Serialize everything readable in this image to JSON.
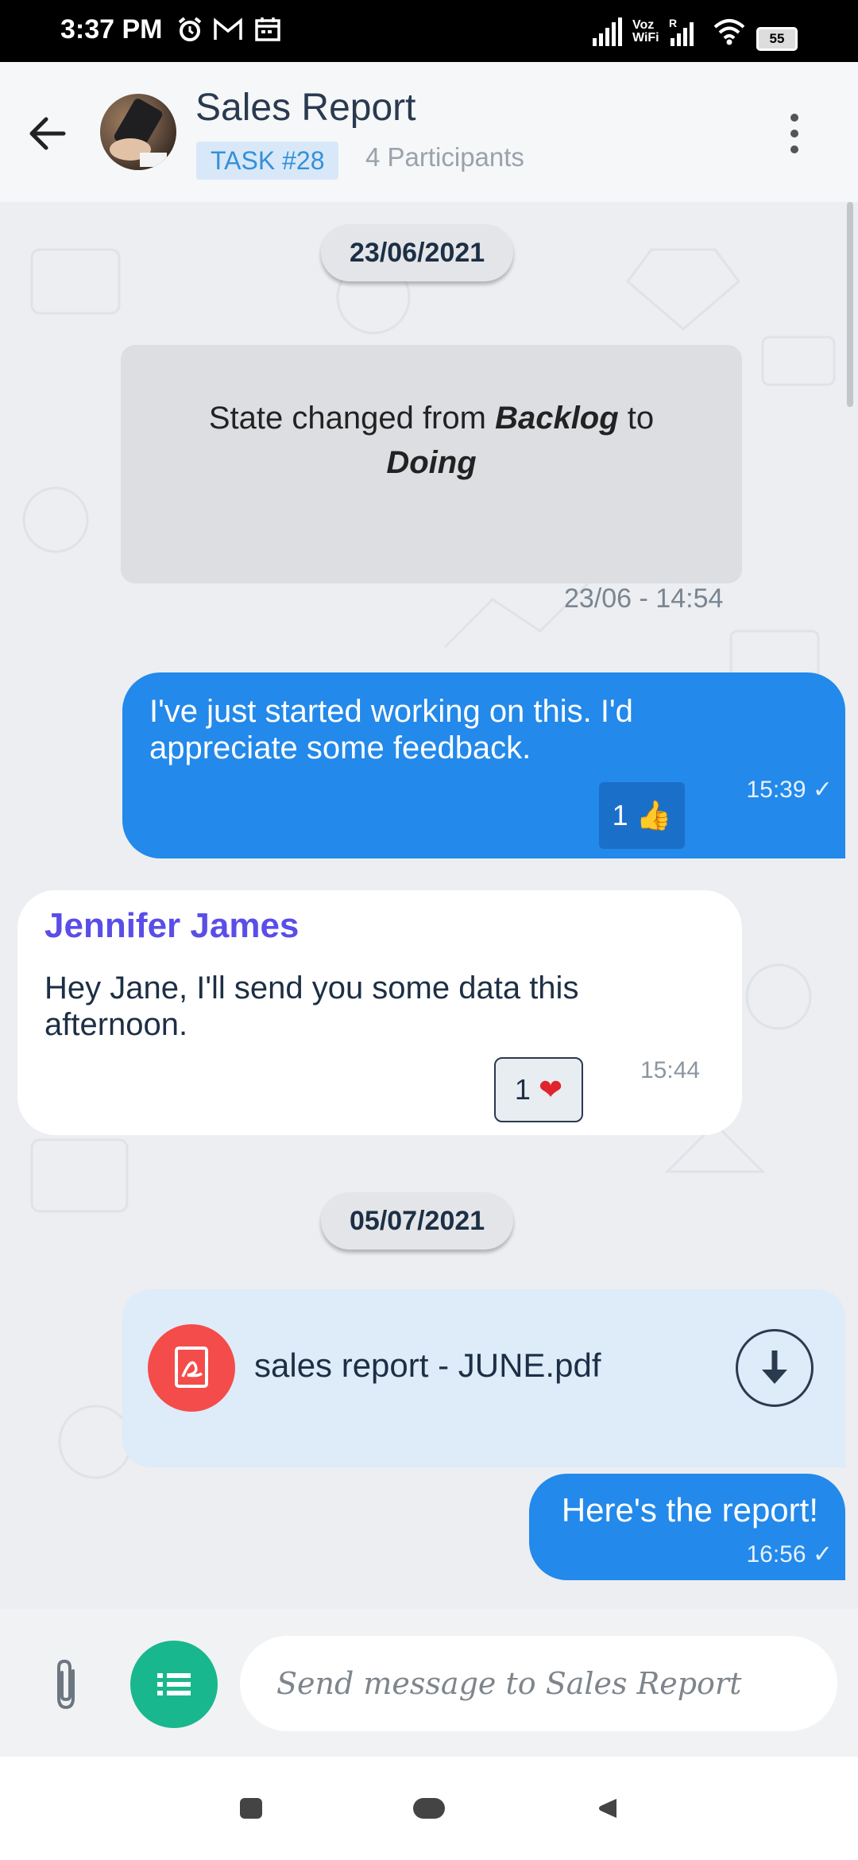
{
  "status_bar": {
    "time": "3:37 PM",
    "battery": "55",
    "icons": [
      "alarm-icon",
      "gmail-icon",
      "calendar-icon",
      "signal-icon",
      "vowifi-icon",
      "wifi-icon",
      "battery-icon"
    ],
    "volte_label": "Voz WiFi R"
  },
  "header": {
    "title": "Sales Report",
    "task_badge": "TASK #28",
    "participants": "4 Participants"
  },
  "chat": {
    "date1": "23/06/2021",
    "system_message": {
      "prefix": "State changed from ",
      "from_state": "Backlog",
      "middle": " to ",
      "to_state": "Doing",
      "time": "23/06 - 14:54"
    },
    "messages": [
      {
        "text": "I've just started working on this. I'd appreciate some feedback.",
        "time": "15:39 ✓",
        "reaction_count": "1",
        "reaction_emoji": "👍"
      },
      {
        "sender": "Jennifer James",
        "text": "Hey Jane, I'll send you some data this afternoon.",
        "time": "15:44",
        "reaction_count": "1",
        "reaction_emoji": "❤"
      }
    ],
    "date2": "05/07/2021",
    "file_message": {
      "file_name": "sales report - JUNE.pdf"
    },
    "last_message": {
      "text": "Here's the report!",
      "time": "16:56 ✓"
    }
  },
  "composer": {
    "placeholder": "Send message to Sales Report"
  },
  "colors": {
    "sent_bubble": "#2389ea",
    "sender_name": "#5a4ee8",
    "list_button": "#19b78e",
    "pdf_icon": "#f44c4a"
  }
}
